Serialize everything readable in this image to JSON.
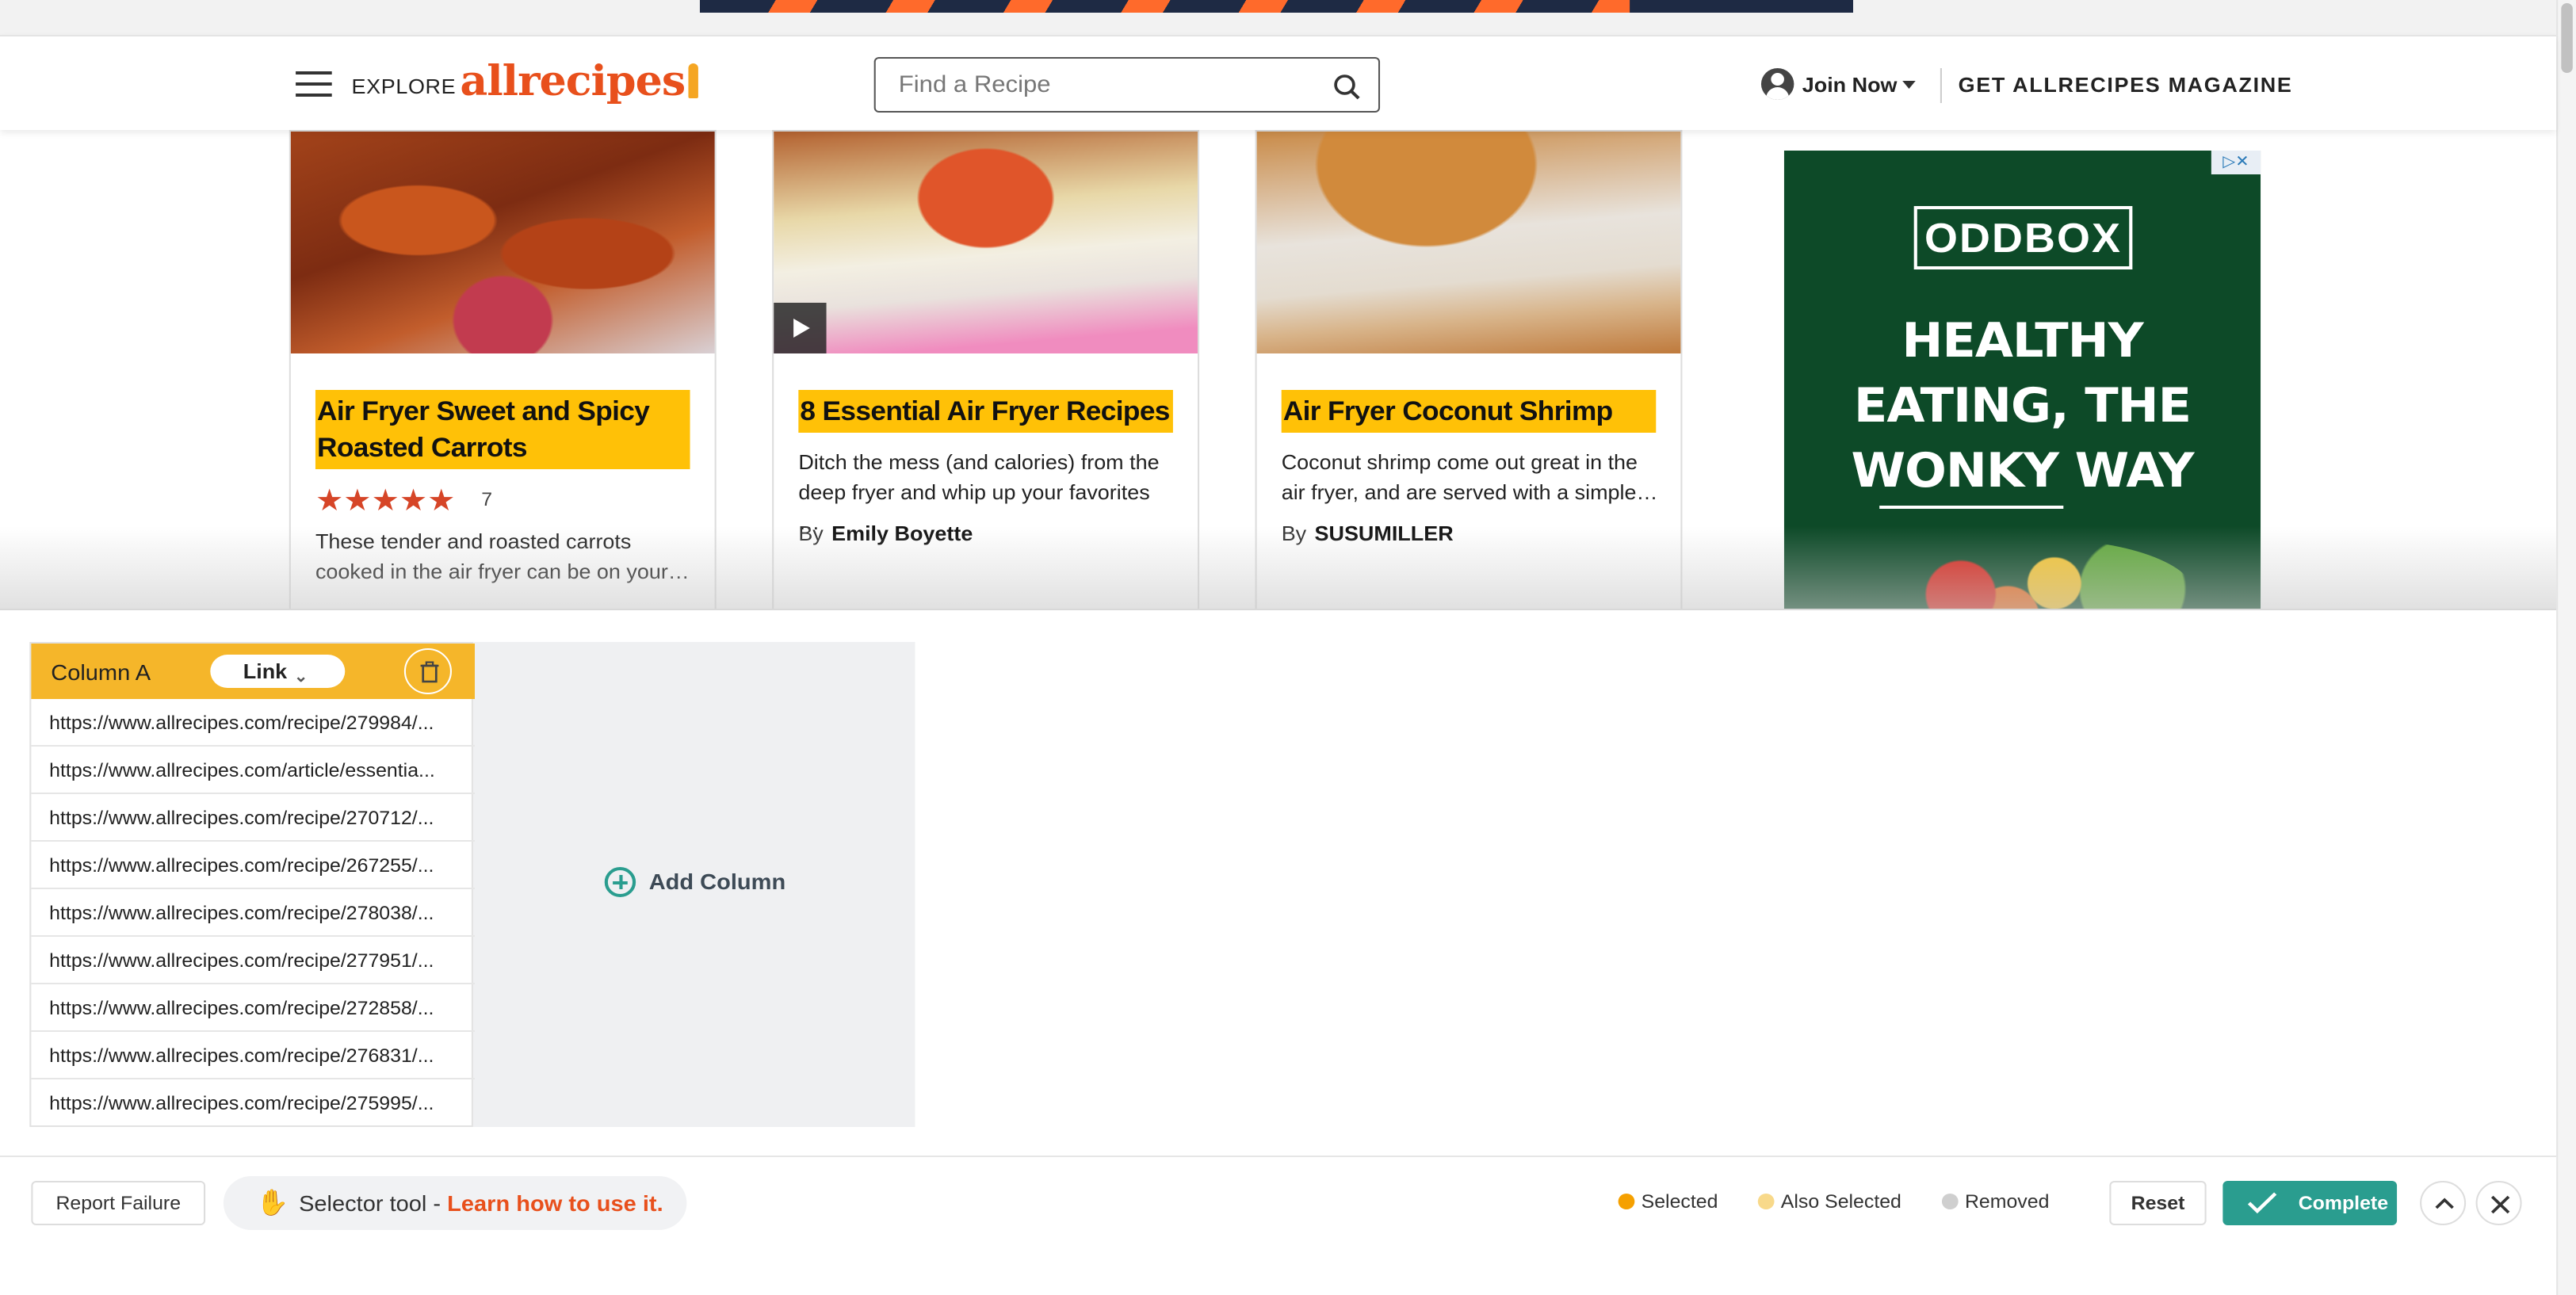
{
  "header": {
    "explore_label": "EXPLORE",
    "logo_text": "allrecipes",
    "search_placeholder": "Find a Recipe",
    "join_label": "Join Now",
    "magazine_label": "GET ALLRECIPES MAGAZINE"
  },
  "cards": [
    {
      "title": "Air Fryer Sweet and Spicy Roasted Carrots",
      "stars": "★★★★★",
      "rating_count": "7",
      "description": "These tender and roasted carrots cooked in the air fryer can be on your…",
      "has_video": false
    },
    {
      "title": "8 Essential Air Fryer Recipes",
      "description": "Ditch the mess (and calories) from the deep fryer and whip up your favorites …",
      "byline_prefix": "By",
      "author": "Emily Boyette",
      "has_video": true
    },
    {
      "title": "Air Fryer Coconut Shrimp",
      "description": "Coconut shrimp come out great in the air fryer, and are served with a simple…",
      "byline_prefix": "By",
      "author": "SUSUMILLER",
      "has_video": false
    }
  ],
  "side_ad": {
    "brand": "ODDBOX",
    "lines": [
      "HEALTHY",
      "EATING, THE",
      "WONKY WAY"
    ],
    "choices": "▷✕"
  },
  "selector_tool": {
    "column": {
      "name": "Column A",
      "type": "Link",
      "rows": [
        "https://www.allrecipes.com/recipe/279984/...",
        "https://www.allrecipes.com/article/essentia...",
        "https://www.allrecipes.com/recipe/270712/...",
        "https://www.allrecipes.com/recipe/267255/...",
        "https://www.allrecipes.com/recipe/278038/...",
        "https://www.allrecipes.com/recipe/277951/...",
        "https://www.allrecipes.com/recipe/272858/...",
        "https://www.allrecipes.com/recipe/276831/...",
        "https://www.allrecipes.com/recipe/275995/..."
      ]
    },
    "add_column_label": "Add Column",
    "report_label": "Report Failure",
    "tool_label": "Selector tool - ",
    "learn_label": "Learn how to use it.",
    "legend": [
      {
        "label": "Selected",
        "color": "#f5a000"
      },
      {
        "label": "Also Selected",
        "color": "#f8d98a"
      },
      {
        "label": "Removed",
        "color": "#cfcfcf"
      }
    ],
    "reset_label": "Reset",
    "complete_label": "Complete"
  },
  "colors": {
    "brand": "#e8501c",
    "highlight": "#ffc107",
    "accent": "#2a9d8f",
    "column_header": "#f5b62a"
  },
  "icons": [
    "hamburger-icon",
    "search-icon",
    "account-icon",
    "play-icon",
    "trash-icon",
    "add-circle-icon",
    "wave-hand-icon",
    "check-icon",
    "chevron-up-icon",
    "close-icon"
  ]
}
